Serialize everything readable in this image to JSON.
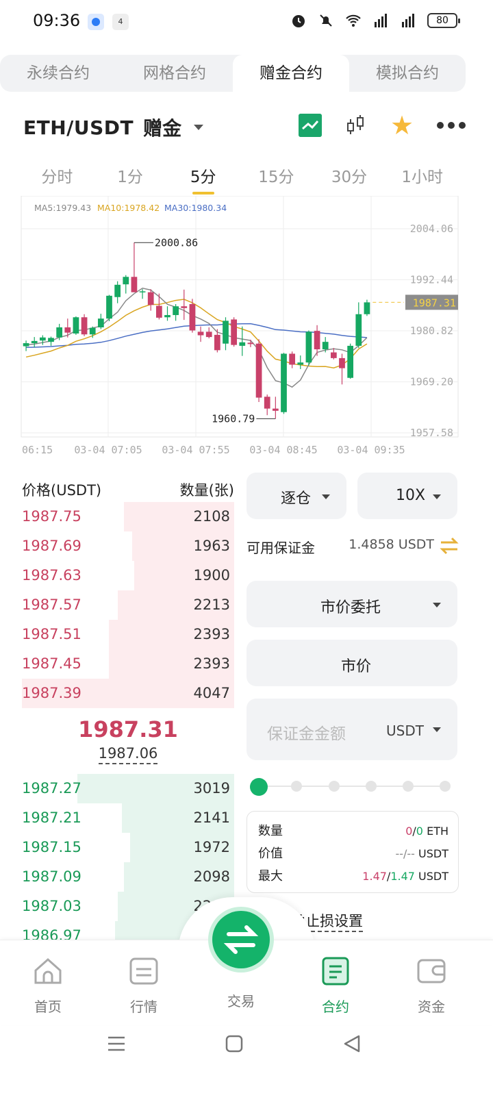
{
  "status_bar": {
    "time": "09:36",
    "mini_badge": "4",
    "battery": "80"
  },
  "contract_tabs": [
    "永续合约",
    "网格合约",
    "赠金合约",
    "模拟合约"
  ],
  "pair": {
    "symbol": "ETH/USDT",
    "mode": "赠金"
  },
  "time_tabs": [
    "分时",
    "1分",
    "5分",
    "15分",
    "30分",
    "1小时"
  ],
  "chart_data": {
    "type": "candlestick",
    "ma_legend": {
      "ma5": "MA5:1979.43",
      "ma10": "MA10:1978.42",
      "ma30": "MA30:1980.34"
    },
    "y_ticks": [
      "2004.06",
      "1992.44",
      "1980.82",
      "1969.20",
      "1957.58"
    ],
    "y_range": [
      1957.58,
      2004.06
    ],
    "x_ticks": [
      "06:15",
      "03-04 07:05",
      "03-04 07:55",
      "03-04 08:45",
      "03-04 09:35"
    ],
    "high_annotation": "2000.86",
    "low_annotation": "1960.79",
    "last_price_label": "1987.31",
    "candles": [
      {
        "o": 1977.3,
        "h": 1978.6,
        "l": 1976.2,
        "c": 1978.0
      },
      {
        "o": 1978.0,
        "h": 1979.4,
        "l": 1977.1,
        "c": 1978.5
      },
      {
        "o": 1978.6,
        "h": 1979.8,
        "l": 1977.6,
        "c": 1979.3
      },
      {
        "o": 1978.3,
        "h": 1979.5,
        "l": 1977.4,
        "c": 1979.2
      },
      {
        "o": 1979.3,
        "h": 1982.4,
        "l": 1978.7,
        "c": 1981.6
      },
      {
        "o": 1981.6,
        "h": 1983.6,
        "l": 1979.3,
        "c": 1980.4
      },
      {
        "o": 1980.2,
        "h": 1984.1,
        "l": 1979.9,
        "c": 1983.9
      },
      {
        "o": 1983.9,
        "h": 1984.6,
        "l": 1979.6,
        "c": 1980.0
      },
      {
        "o": 1980.0,
        "h": 1981.8,
        "l": 1979.2,
        "c": 1981.5
      },
      {
        "o": 1981.6,
        "h": 1984.7,
        "l": 1981.2,
        "c": 1983.6
      },
      {
        "o": 1983.6,
        "h": 1989.0,
        "l": 1983.0,
        "c": 1988.8
      },
      {
        "o": 1988.5,
        "h": 1992.1,
        "l": 1987.1,
        "c": 1991.3
      },
      {
        "o": 1991.4,
        "h": 1993.5,
        "l": 1989.3,
        "c": 1993.1
      },
      {
        "o": 1993.1,
        "h": 2000.9,
        "l": 1989.6,
        "c": 1989.6
      },
      {
        "o": 1989.6,
        "h": 1990.3,
        "l": 1988.1,
        "c": 1989.8
      },
      {
        "o": 1989.6,
        "h": 1990.3,
        "l": 1985.4,
        "c": 1986.7
      },
      {
        "o": 1986.5,
        "h": 1989.3,
        "l": 1983.4,
        "c": 1983.8
      },
      {
        "o": 1983.9,
        "h": 1986.4,
        "l": 1983.1,
        "c": 1984.4
      },
      {
        "o": 1984.4,
        "h": 1986.9,
        "l": 1983.1,
        "c": 1986.4
      },
      {
        "o": 1986.4,
        "h": 1990.2,
        "l": 1983.3,
        "c": 1986.0
      },
      {
        "o": 1986.9,
        "h": 1988.1,
        "l": 1980.4,
        "c": 1980.9
      },
      {
        "o": 1980.6,
        "h": 1981.8,
        "l": 1978.3,
        "c": 1979.8
      },
      {
        "o": 1980.6,
        "h": 1981.6,
        "l": 1979.1,
        "c": 1979.4
      },
      {
        "o": 1979.9,
        "h": 1981.2,
        "l": 1975.9,
        "c": 1976.4
      },
      {
        "o": 1977.9,
        "h": 1983.9,
        "l": 1976.4,
        "c": 1983.1
      },
      {
        "o": 1983.4,
        "h": 1983.9,
        "l": 1977.2,
        "c": 1977.6
      },
      {
        "o": 1977.4,
        "h": 1981.8,
        "l": 1975.1,
        "c": 1978.2
      },
      {
        "o": 1978.1,
        "h": 1978.8,
        "l": 1977.1,
        "c": 1977.8
      },
      {
        "o": 1977.9,
        "h": 1978.9,
        "l": 1964.6,
        "c": 1965.6
      },
      {
        "o": 1965.8,
        "h": 1966.3,
        "l": 1961.6,
        "c": 1963.1
      },
      {
        "o": 1963.1,
        "h": 1965.8,
        "l": 1960.8,
        "c": 1962.6
      },
      {
        "o": 1962.3,
        "h": 1975.8,
        "l": 1961.9,
        "c": 1975.6
      },
      {
        "o": 1975.6,
        "h": 1976.1,
        "l": 1972.3,
        "c": 1973.1
      },
      {
        "o": 1973.1,
        "h": 1975.2,
        "l": 1972.1,
        "c": 1973.6
      },
      {
        "o": 1973.6,
        "h": 1980.9,
        "l": 1972.9,
        "c": 1980.6
      },
      {
        "o": 1980.8,
        "h": 1982.1,
        "l": 1975.1,
        "c": 1976.6
      },
      {
        "o": 1976.6,
        "h": 1979.4,
        "l": 1975.9,
        "c": 1978.3
      },
      {
        "o": 1975.9,
        "h": 1976.9,
        "l": 1974.3,
        "c": 1974.6
      },
      {
        "o": 1974.6,
        "h": 1975.6,
        "l": 1968.6,
        "c": 1972.3
      },
      {
        "o": 1970.1,
        "h": 1977.9,
        "l": 1969.9,
        "c": 1977.4
      },
      {
        "o": 1977.4,
        "h": 1987.3,
        "l": 1976.9,
        "c": 1984.6
      },
      {
        "o": 1984.6,
        "h": 1987.9,
        "l": 1984.2,
        "c": 1987.3
      }
    ]
  },
  "order_book": {
    "price_header": "价格(USDT)",
    "qty_header": "数量(张)",
    "asks": [
      {
        "price": "1987.75",
        "qty": "2108",
        "depth": 0.52
      },
      {
        "price": "1987.69",
        "qty": "1963",
        "depth": 0.48
      },
      {
        "price": "1987.63",
        "qty": "1900",
        "depth": 0.47
      },
      {
        "price": "1987.57",
        "qty": "2213",
        "depth": 0.55
      },
      {
        "price": "1987.51",
        "qty": "2393",
        "depth": 0.59
      },
      {
        "price": "1987.45",
        "qty": "2393",
        "depth": 0.59
      },
      {
        "price": "1987.39",
        "qty": "4047",
        "depth": 1.0
      }
    ],
    "last_price": "1987.31",
    "mark_price": "1987.06",
    "bids": [
      {
        "price": "1987.27",
        "qty": "3019",
        "depth": 0.74
      },
      {
        "price": "1987.21",
        "qty": "2141",
        "depth": 0.53
      },
      {
        "price": "1987.15",
        "qty": "1972",
        "depth": 0.49
      },
      {
        "price": "1987.09",
        "qty": "2098",
        "depth": 0.52
      },
      {
        "price": "1987.03",
        "qty": "2217",
        "depth": 0.55
      },
      {
        "price": "1986.97",
        "qty": "",
        "depth": 0.56
      }
    ]
  },
  "order_panel": {
    "margin_mode": "逐仓",
    "leverage": "10X",
    "available_label": "可用保证金",
    "available_value": "1.4858 USDT",
    "order_type": "市价委托",
    "price_mode": "市价",
    "amount_placeholder": "保证金金额",
    "amount_unit": "USDT",
    "slider_level": 0,
    "info": {
      "qty_label": "数量",
      "qty_long": "0",
      "qty_sep": "/",
      "qty_short": "0",
      "qty_unit": "ETH",
      "value_label": "价值",
      "value_val": "--/--",
      "value_unit": "USDT",
      "max_label": "最大",
      "max_long": "1.47",
      "max_sep": "/",
      "max_short": "1.47",
      "max_unit": "USDT"
    },
    "tpsl_label": "止盈止损设置"
  },
  "bottom_nav": [
    {
      "label": "首页",
      "icon": "home-icon"
    },
    {
      "label": "行情",
      "icon": "market-icon"
    },
    {
      "label": "交易",
      "icon": "trade-swap-icon"
    },
    {
      "label": "合约",
      "icon": "contract-icon"
    },
    {
      "label": "资金",
      "icon": "wallet-icon"
    }
  ],
  "colors": {
    "up": "#16a862",
    "down": "#c9416a",
    "accent": "#14b36a",
    "ma5": "#888888",
    "ma10": "#d9a520",
    "ma30": "#4a6ec4"
  }
}
